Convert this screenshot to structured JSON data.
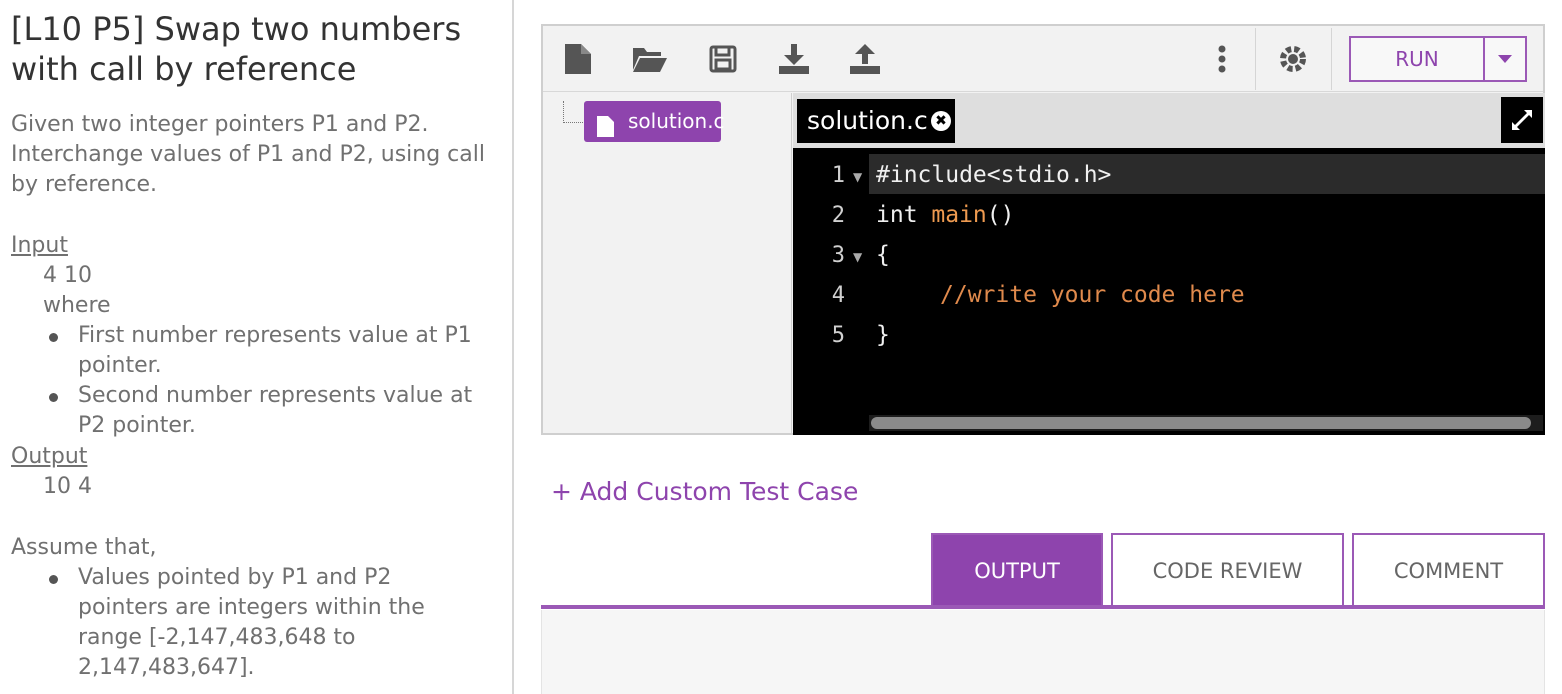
{
  "problem": {
    "title": "[L10 P5] Swap two numbers with call by reference",
    "description": "Given two integer pointers P1 and P2. Interchange values of P1 and P2, using call by reference.",
    "input_heading": "Input",
    "input_example": "4 10",
    "input_where": "where",
    "input_bullets": [
      "First number represents value at P1 pointer.",
      "Second number represents value at P2 pointer."
    ],
    "output_heading": "Output",
    "output_example": "10 4",
    "assume_heading": "Assume that,",
    "assume_bullets": [
      "Values pointed by P1 and P2 pointers are integers within the range [-2,147,483,648 to 2,147,483,647]."
    ]
  },
  "toolbar": {
    "icons": [
      "new-file-icon",
      "open-folder-icon",
      "save-icon",
      "download-icon",
      "upload-icon",
      "more-vertical-icon",
      "settings-icon"
    ],
    "run_label": "RUN"
  },
  "file_tree": {
    "files": [
      "solution.c"
    ]
  },
  "editor": {
    "tab_label": "solution.c",
    "close_glyph": "✖",
    "lines": [
      {
        "num": "1",
        "folded": true
      },
      {
        "num": "2",
        "folded": false
      },
      {
        "num": "3",
        "folded": true
      },
      {
        "num": "4",
        "folded": false
      },
      {
        "num": "5",
        "folded": false
      }
    ],
    "code": {
      "l1": "#include<stdio.h>",
      "l2_kw": "int ",
      "l2_fn": "main",
      "l2_rest": "()",
      "l3": "{",
      "l4": "//write your code here",
      "l5": "}"
    }
  },
  "add_custom_test_case": "+ Add Custom Test Case",
  "output_tabs": [
    "OUTPUT",
    "CODE REVIEW",
    "COMMENT"
  ],
  "colors": {
    "accent": "#8e44ad",
    "editor_bg": "#000000",
    "comment": "#e08a4c"
  }
}
